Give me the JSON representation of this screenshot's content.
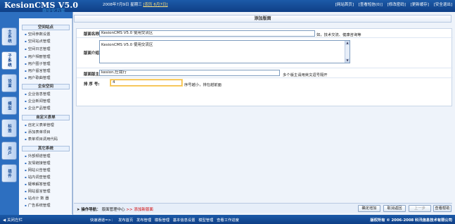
{
  "app": {
    "logo": "KesionCMS V5.0",
    "logo_sub": "商业化方案"
  },
  "topbar": {
    "date": "2008年7月9日 星期三",
    "lunar": "[农历 6月7日]",
    "links": [
      "[网站首页]",
      "[查看短信(0)]",
      "[修改密码]",
      "[更新缓存]",
      "[安全退出]"
    ]
  },
  "left_tabs": [
    "主系统",
    "子系统",
    "设置",
    "模型",
    "标签",
    "用户",
    "插件"
  ],
  "menu": {
    "sections": [
      {
        "title": "空间站点",
        "items": [
          "空间参数设置",
          "空间站点管理",
          "空间日志管理",
          "用户相册管理",
          "用户圈子管理",
          "用户留言管理",
          "用户歌曲管理"
        ]
      },
      {
        "title": "企业空间",
        "items": [
          "企业信息管理",
          "企业新闻管理",
          "企业产品管理"
        ]
      },
      {
        "title": "自定义表单",
        "items": [
          "自定义表单管理",
          "添加表单项目",
          "表单项目调用代码"
        ]
      },
      {
        "title": "其它系统",
        "items": [
          "外部频道管理",
          "友情链接管理",
          "网站公告管理",
          "站内调查管理",
          "疑难解答管理",
          "网站留言管理",
          "站点计 数 器",
          "广告系统管理"
        ]
      }
    ]
  },
  "page": {
    "title": "添加版面"
  },
  "form": {
    "name_label": "版面名称:",
    "name_value": "KesionCMS V5.0 使用交流区",
    "name_hint": "如，技术交流、健康咨询等",
    "intro_label": "版面介绍:",
    "intro_value": "KesionCMS V5.0 使用交流区",
    "moderator_label": "版面版主:",
    "moderator_value": "kesion,任我行",
    "moderator_hint": "多个版主请用英文逗号隔开",
    "sort_label": "排 序 号:",
    "sort_value": "4",
    "sort_hint": "序号越小，排在越前面"
  },
  "navbar": {
    "label": "操作导航：",
    "path1": "版面管理中心",
    "sep": ">>",
    "path2": "添加新版面"
  },
  "buttons": {
    "confirm": "确定增加",
    "cancel": "取消返回",
    "prev": "上一步",
    "help": "查看帮助"
  },
  "bottombar": {
    "close_left": "关闭左栏",
    "quick_label": "快速通道=>：",
    "quick_links": [
      "发布首页",
      "发布管理",
      "模板管理",
      "基本信息设置",
      "模型管理",
      "查看工作进度"
    ],
    "copyright": "版权所有 © 2006-2008 科汛信息技术有限公司"
  },
  "colors": {
    "header_bg": "#1c5aa8",
    "accent": "#2d6fc0",
    "nav_red": "#d20000"
  }
}
